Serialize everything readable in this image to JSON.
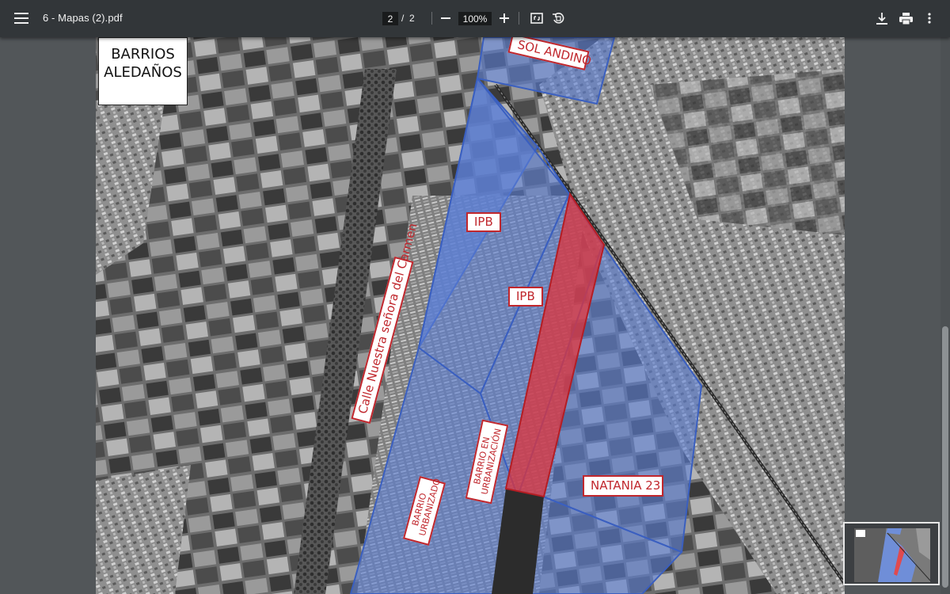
{
  "toolbar": {
    "document_title": "6 - Mapas (2).pdf",
    "current_page": "2",
    "page_separator": "/",
    "total_pages": "2",
    "zoom": "100%",
    "icons": {
      "menu": "menu-icon",
      "zoom_out": "minus-icon",
      "zoom_in": "plus-icon",
      "fit": "fit-to-page-icon",
      "rotate": "rotate-icon",
      "download": "download-icon",
      "print": "print-icon",
      "more": "more-vert-icon"
    }
  },
  "map": {
    "title_line1": "BARRIOS",
    "title_line2": "ALEDAÑOS",
    "labels": {
      "sol_andino": "SOL ANDINO",
      "ipb_1": "IPB",
      "ipb_2": "IPB",
      "calle": "Calle Nuestra señora del Carmen",
      "barrio_en_urbanizacion": "BARRIO EN URBANIZACIÓN",
      "barrio_urbanizado": "BARRIO URBANIZADO",
      "natania": "NATANIA 23"
    },
    "colors": {
      "blue_overlay": "#5b7fd6",
      "red_overlay": "#e0333a",
      "label_border": "#c0272d"
    }
  },
  "colors": {
    "toolbar_bg": "#323639",
    "viewer_bg": "#525659",
    "text": "#f1f1f1"
  }
}
